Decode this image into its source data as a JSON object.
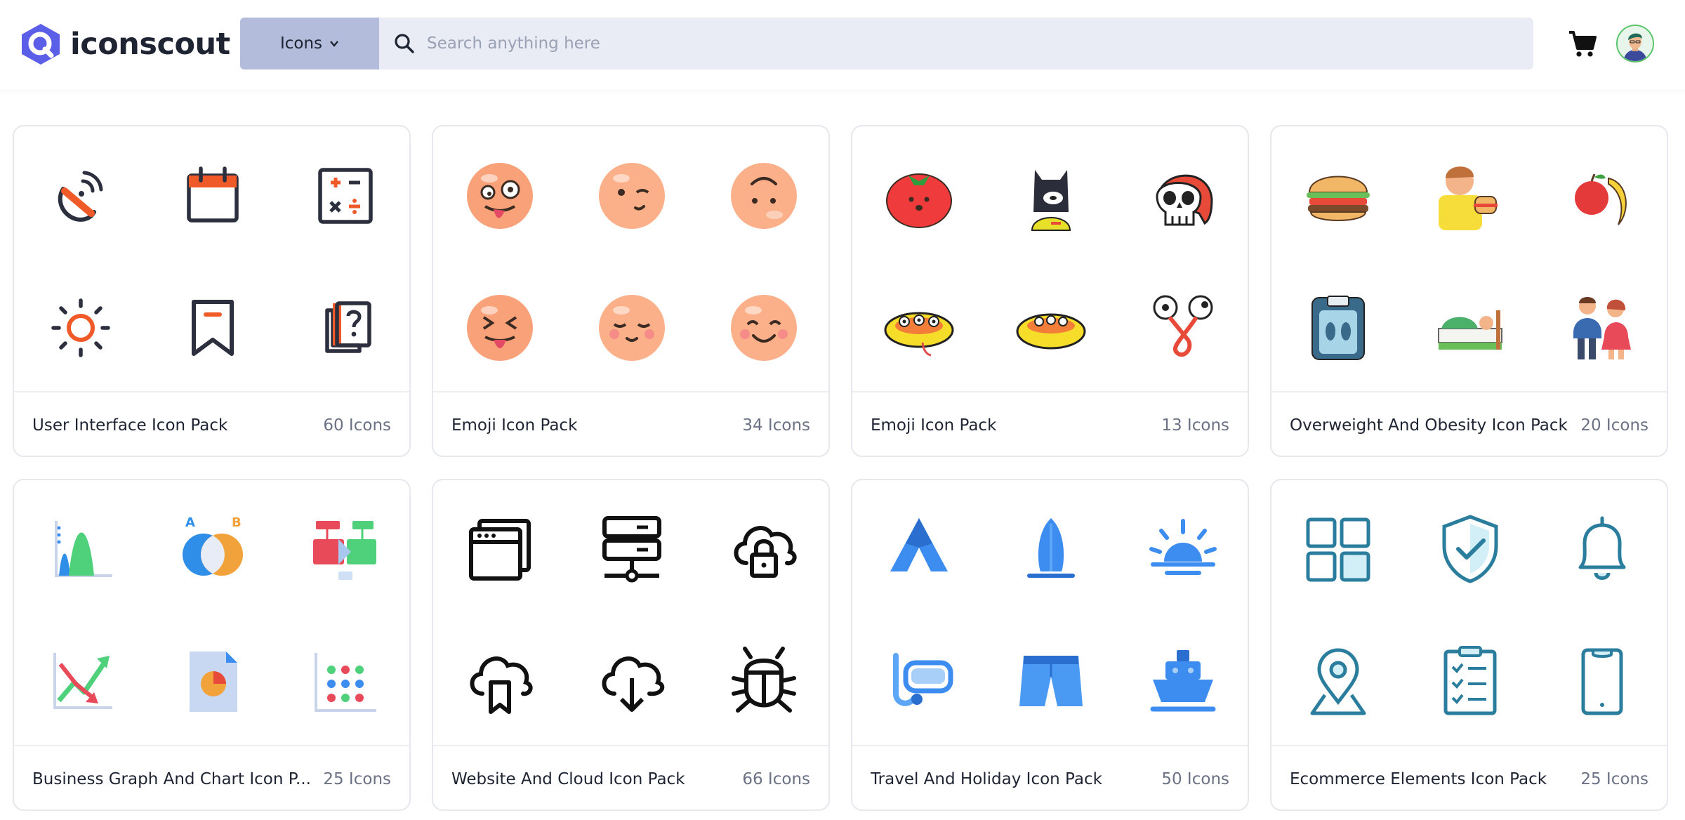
{
  "brand": {
    "name": "iconscout"
  },
  "search": {
    "type_label": "Icons",
    "placeholder": "Search anything here",
    "value": ""
  },
  "packs": [
    {
      "title": "User Interface Icon Pack",
      "count": "60 Icons",
      "icons": [
        "satellite-dish-icon",
        "calendar-icon",
        "calculator-icon",
        "sun-icon",
        "bookmark-icon",
        "help-book-icon"
      ]
    },
    {
      "title": "Emoji Icon Pack",
      "count": "34 Icons",
      "icons": [
        "crazy-face-emoji",
        "winking-face-emoji",
        "upside-down-face-emoji",
        "squinting-tongue-emoji",
        "relieved-face-emoji",
        "smiling-face-emoji"
      ]
    },
    {
      "title": "Emoji Icon Pack",
      "count": "13 Icons",
      "icons": [
        "tomato-icon",
        "bat-character-icon",
        "skull-helmet-icon",
        "three-eyed-blob-icon",
        "yellow-blob-icon",
        "eyes-on-string-icon"
      ]
    },
    {
      "title": "Overweight And Obesity Icon Pack",
      "count": "20 Icons",
      "icons": [
        "burger-icon",
        "person-eating-burger-icon",
        "apple-banana-icon",
        "weight-scale-icon",
        "person-in-bed-icon",
        "overweight-couple-icon"
      ]
    },
    {
      "title": "Business Graph And Chart Icon P...",
      "count": "25 Icons",
      "icons": [
        "area-chart-icon",
        "venn-diagram-icon",
        "flow-chart-icon",
        "trend-arrows-chart-icon",
        "pie-report-icon",
        "dot-matrix-chart-icon"
      ]
    },
    {
      "title": "Website And Cloud Icon Pack",
      "count": "66 Icons",
      "icons": [
        "browser-windows-icon",
        "server-network-icon",
        "cloud-lock-icon",
        "cloud-bookmark-icon",
        "cloud-download-icon",
        "bug-icon"
      ]
    },
    {
      "title": "Travel And Holiday Icon Pack",
      "count": "50 Icons",
      "icons": [
        "tent-icon",
        "surfboard-icon",
        "sunrise-icon",
        "snorkel-mask-icon",
        "swim-shorts-icon",
        "ship-icon"
      ]
    },
    {
      "title": "Ecommerce Elements Icon Pack",
      "count": "25 Icons",
      "icons": [
        "grid-apps-icon",
        "shield-check-icon",
        "bell-icon",
        "location-pin-icon",
        "checklist-icon",
        "smartphone-icon"
      ]
    }
  ],
  "colors": {
    "accent": "#5b5fe8",
    "search_bg": "#e9ecf4",
    "select_bg": "#b3bddb",
    "ui_orange": "#f05a28",
    "teal": "#2a7d9c",
    "blue": "#3d8cf0"
  }
}
